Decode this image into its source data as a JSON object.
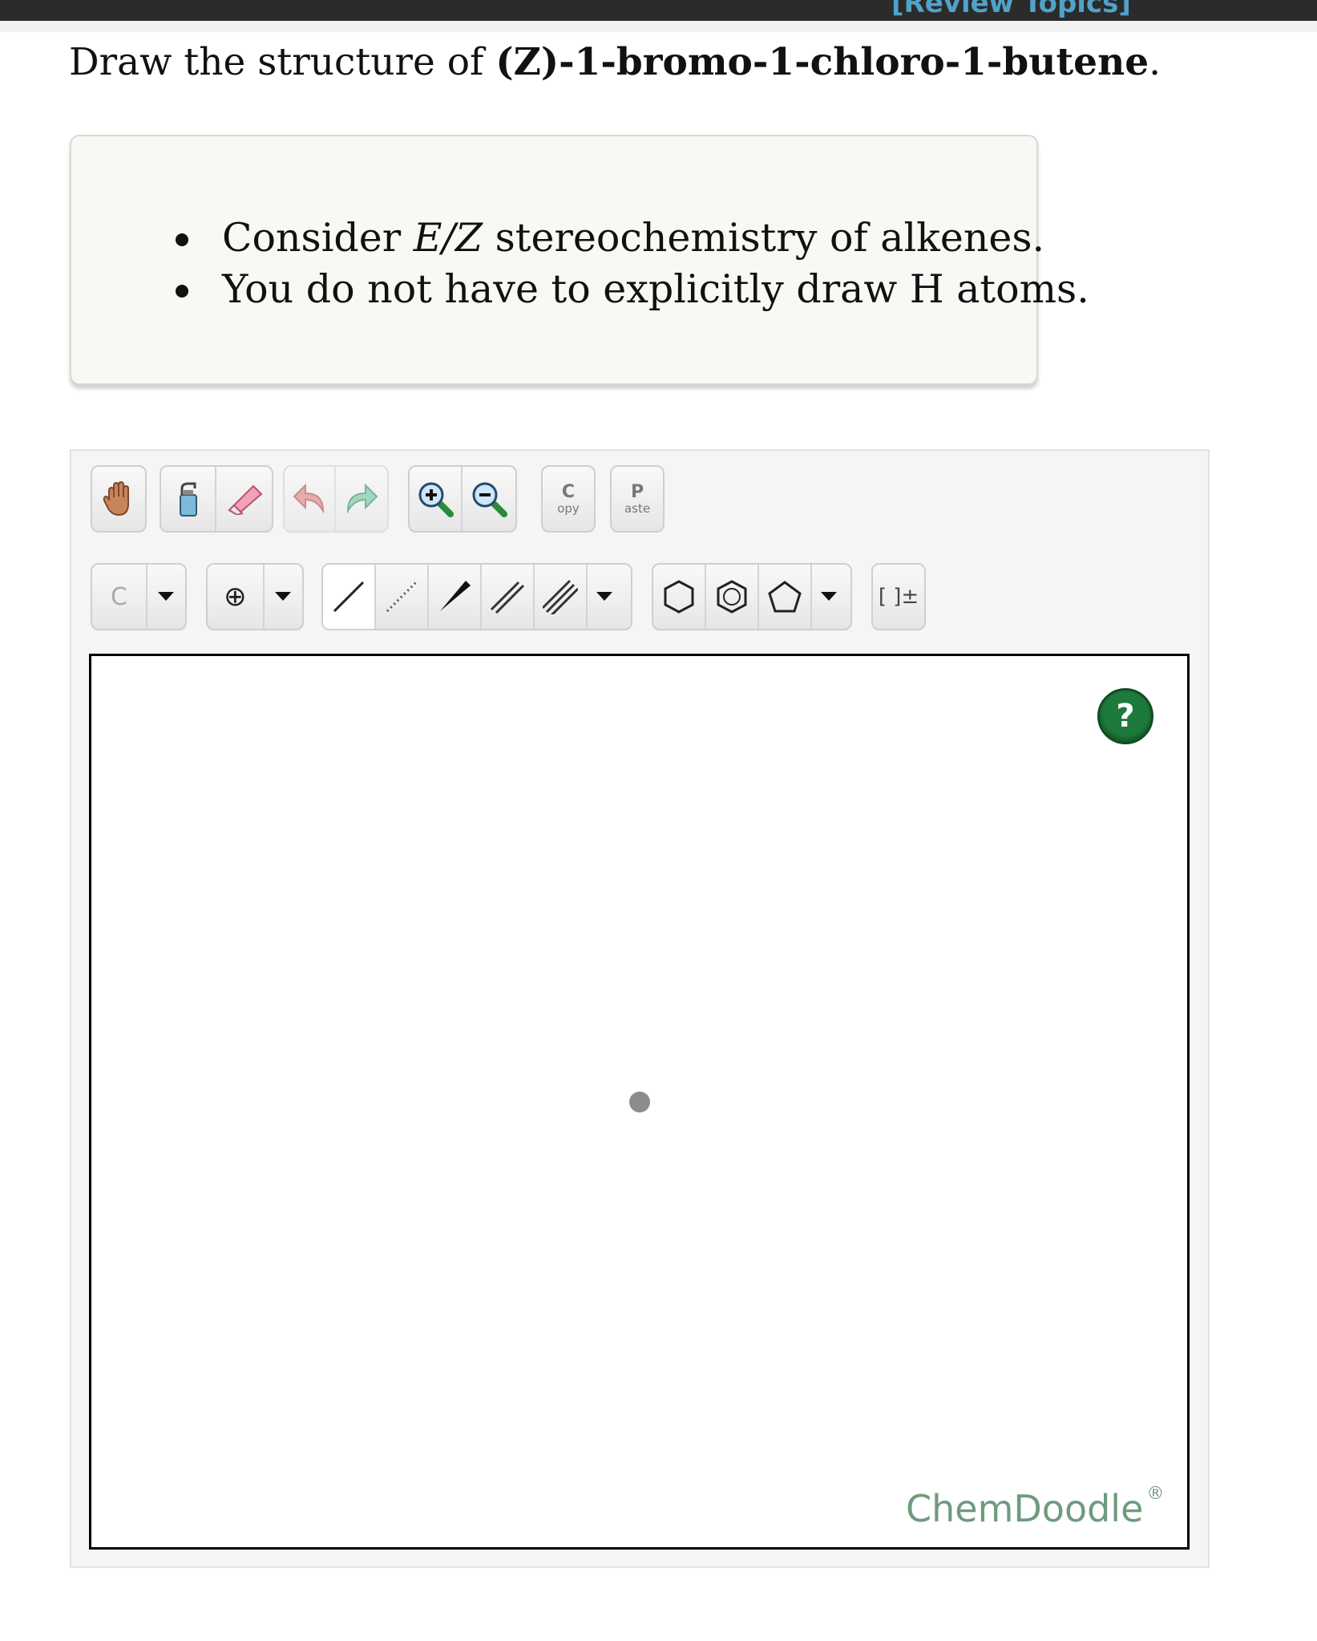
{
  "top_bar": {
    "link_label": "[Review Topics]"
  },
  "question": {
    "prefix": "Draw the structure of ",
    "compound": "(Z)-1-bromo-1-chloro-1-butene",
    "suffix": "."
  },
  "hints": {
    "item1_pre": "Consider ",
    "item1_em": "E/Z",
    "item1_post": " stereochemistry of alkenes.",
    "item2": "You do not have to explicitly draw H atoms."
  },
  "toolbar": {
    "copy_label_big": "C",
    "copy_label_small": "opy",
    "paste_label_big": "P",
    "paste_label_small": "aste",
    "element_label": "C",
    "charge_label": "⊕",
    "bracket_label": "[ ]±",
    "icons": [
      "hand-icon",
      "lasso-icon",
      "eraser-icon",
      "undo-icon",
      "redo-icon",
      "zoom-in-icon",
      "zoom-out-icon"
    ]
  },
  "canvas": {
    "help_label": "?",
    "brand": "ChemDoodle",
    "brand_mark": "®"
  },
  "colors": {
    "help_button": "#1e7a3c",
    "brand_text": "#6f9a7e",
    "link": "#4fa3c9"
  }
}
